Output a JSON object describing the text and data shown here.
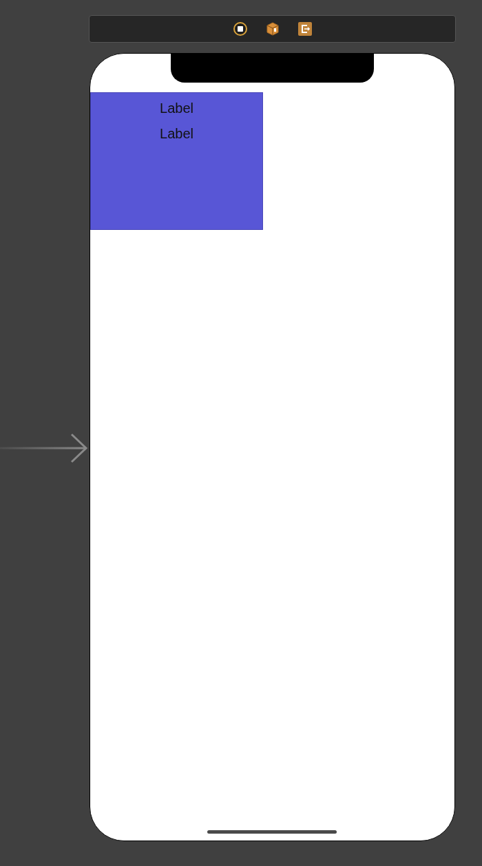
{
  "scene": {
    "view": {
      "labels": [
        "Label",
        "Label"
      ]
    }
  }
}
